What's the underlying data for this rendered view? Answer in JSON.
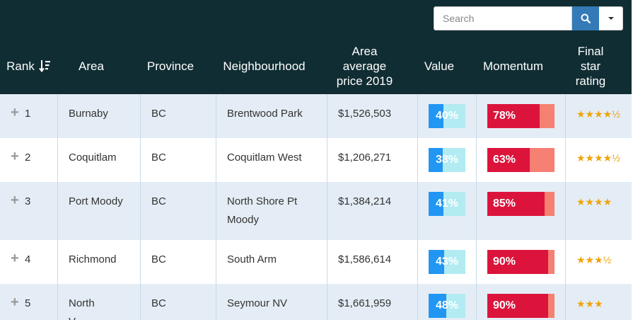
{
  "search": {
    "placeholder": "Search"
  },
  "headers": {
    "rank": "Rank",
    "area": "Area",
    "province": "Province",
    "neighbourhood": "Neighbourhood",
    "price_l1": "Area",
    "price_l2": "average",
    "price_l3": "price 2019",
    "value": "Value",
    "momentum": "Momentum",
    "rating_l1": "Final",
    "rating_l2": "star",
    "rating_l3": "rating"
  },
  "rows": [
    {
      "rank": "1",
      "area": "Burnaby",
      "area2": "",
      "province": "BC",
      "neigh1": "Brentwood Park",
      "neigh2": "",
      "price": "$1,526,503",
      "value_label": "40%",
      "value_pct": 40,
      "momentum_label": "78%",
      "momentum_pct": 78,
      "stars": "★★★★½"
    },
    {
      "rank": "2",
      "area": "Coquitlam",
      "area2": "",
      "province": "BC",
      "neigh1": "Coquitlam West",
      "neigh2": "",
      "price": "$1,206,271",
      "value_label": "38%",
      "value_pct": 38,
      "momentum_label": "63%",
      "momentum_pct": 63,
      "stars": "★★★★½"
    },
    {
      "rank": "3",
      "area": "Port Moody",
      "area2": "",
      "province": "BC",
      "neigh1": "North Shore Pt",
      "neigh2": "Moody",
      "price": "$1,384,214",
      "value_label": "41%",
      "value_pct": 41,
      "momentum_label": "85%",
      "momentum_pct": 85,
      "stars": "★★★★"
    },
    {
      "rank": "4",
      "area": "Richmond",
      "area2": "",
      "province": "BC",
      "neigh1": "South Arm",
      "neigh2": "",
      "price": "$1,586,614",
      "value_label": "43%",
      "value_pct": 43,
      "momentum_label": "90%",
      "momentum_pct": 90,
      "stars": "★★★½"
    },
    {
      "rank": "5",
      "area": "North",
      "area2": "V",
      "province": "BC",
      "neigh1": "Seymour NV",
      "neigh2": "",
      "price": "$1,661,959",
      "value_label": "48%",
      "value_pct": 48,
      "momentum_label": "90%",
      "momentum_pct": 90,
      "stars": "★★★"
    }
  ]
}
